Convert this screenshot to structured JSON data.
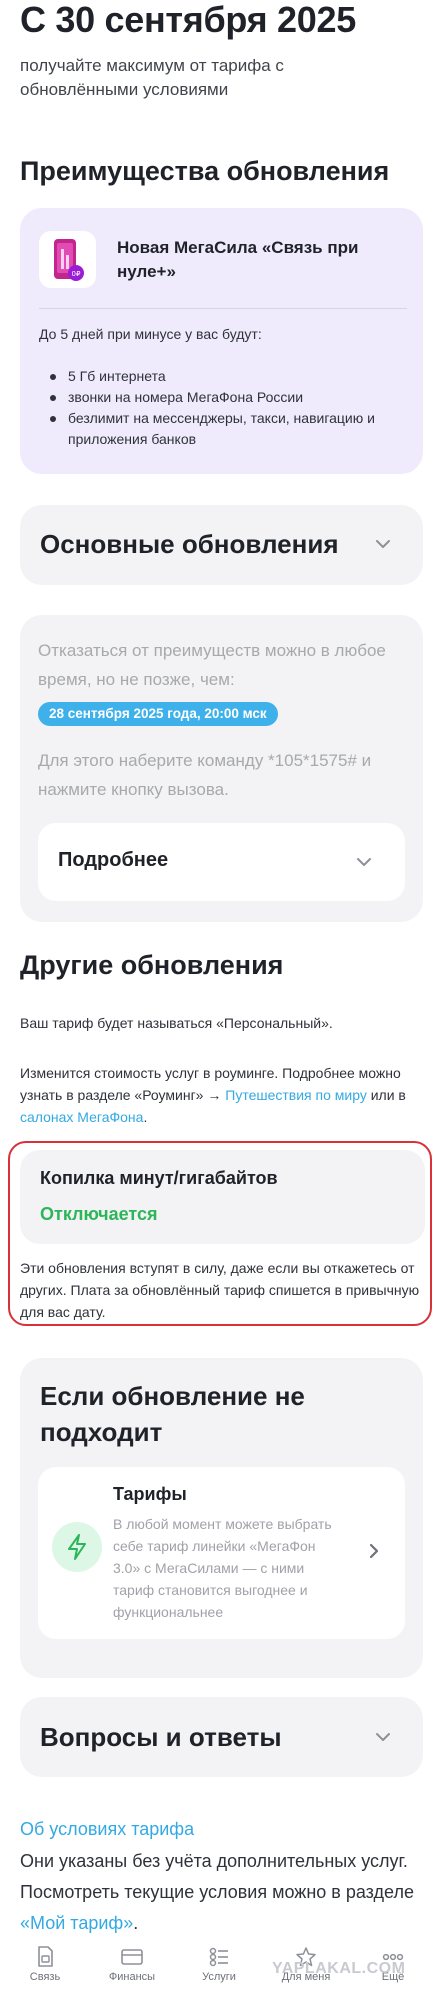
{
  "hero": {
    "title": "С 30 сентября 2025",
    "subtitle": "получайте максимум от тарифа с обновлёнными условиями"
  },
  "benefits": {
    "heading": "Преимущества обновления",
    "promo_title": "Новая МегаСила «Связь при нуле+»",
    "lead": "До 5 дней при минусе у вас будут:",
    "bullets": [
      "5 Гб интернета",
      "звонки на номера МегаФона России",
      "безлимит на мессенджеры, такси, навигацию и приложения банков"
    ]
  },
  "main_updates": {
    "title": "Основные обновления"
  },
  "opt_out": {
    "text1": "Отказаться от преимуществ можно в любое время, но не позже, чем:",
    "deadline": "28 сентября 2025 года, 20:00 мск",
    "text2": "Для этого наберите команду *105*1575# и нажмите кнопку вызова.",
    "more_label": "Подробнее"
  },
  "other": {
    "heading": "Другие обновления",
    "tariff_rename": "Ваш тариф будет называться «Персональный».",
    "roaming_text": "Изменится стоимость услуг в роуминге. Подробнее можно узнать в разделе «Роуминг» → ",
    "roaming_link1": "Путешествия по миру",
    "roaming_mid": " или в ",
    "roaming_link2": "салонах МегаФона",
    "roaming_end": ".",
    "piggy_title": "Копилка минут/гигабайтов",
    "piggy_status": "Отключается",
    "note": "Эти обновления вступят в силу, даже если вы откажетесь от других. Плата за обновлённый тариф спишется в привычную для вас дату."
  },
  "not_fit": {
    "heading": "Если обновление не подходит",
    "tile_title": "Тарифы",
    "tile_text": "В любой момент можете выбрать себе тариф линейки «МегаФон 3.0» с МегаСилами — с ними тариф становится выгоднее и функциональнее"
  },
  "faq": {
    "title": "Вопросы и ответы"
  },
  "footer": {
    "link": "Об условиях тарифа",
    "text": "Они указаны без учёта дополнительных услуг. Посмотреть текущие условия можно в разделе ",
    "text_link": "«Мой тариф»",
    "text_end": "."
  },
  "tabbar": {
    "items": [
      {
        "label": "Связь",
        "icon": "sim-icon"
      },
      {
        "label": "Финансы",
        "icon": "card-icon"
      },
      {
        "label": "Услуги",
        "icon": "services-icon"
      },
      {
        "label": "Для меня",
        "icon": "star-icon"
      },
      {
        "label": "Ещё",
        "icon": "more-icon"
      }
    ]
  },
  "watermark": "YAPLAKAL.COM",
  "colors": {
    "accent_green": "#2db55a",
    "link_blue": "#33a9e3",
    "pill_blue": "#3fb1ea",
    "promo_bg": "#efeafc",
    "frame_red": "#d8313a"
  }
}
